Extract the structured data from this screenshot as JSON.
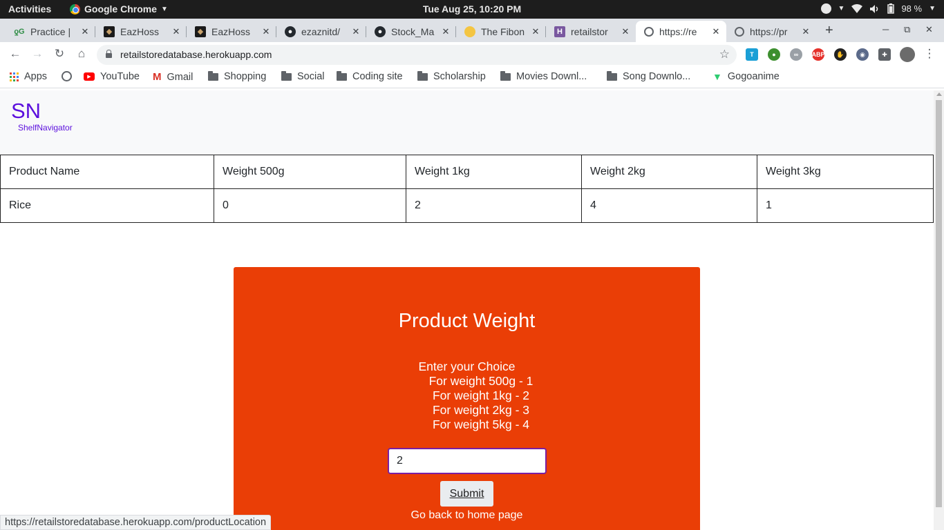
{
  "system_bar": {
    "activities": "Activities",
    "app_name": "Google Chrome",
    "clock": "Tue Aug 25, 10:20 PM",
    "battery": "98 %"
  },
  "tabs": [
    {
      "title": "Practice |",
      "favicon": "gfg-icon",
      "active": false
    },
    {
      "title": "EazHoss",
      "favicon": "page-icon",
      "active": false
    },
    {
      "title": "EazHoss",
      "favicon": "page-icon",
      "active": false
    },
    {
      "title": "ezaznitd/",
      "favicon": "github-icon",
      "active": false
    },
    {
      "title": "Stock_Ma",
      "favicon": "github-icon",
      "active": false
    },
    {
      "title": "The Fibon",
      "favicon": "person-icon",
      "active": false
    },
    {
      "title": "retailstor",
      "favicon": "heroku-icon",
      "active": false
    },
    {
      "title": "https://re",
      "favicon": "globe-icon",
      "active": true
    },
    {
      "title": "https://pr",
      "favicon": "globe-icon",
      "active": false
    }
  ],
  "toolbar": {
    "url": "retailstoredatabase.herokuapp.com"
  },
  "bookmarks": [
    {
      "label": "Apps",
      "icon": "apps-grid-icon"
    },
    {
      "label": "",
      "icon": "globe-icon"
    },
    {
      "label": "YouTube",
      "icon": "youtube-icon"
    },
    {
      "label": "Gmail",
      "icon": "gmail-icon"
    },
    {
      "label": "Shopping",
      "icon": "folder-icon"
    },
    {
      "label": "Social",
      "icon": "folder-icon"
    },
    {
      "label": "Coding site",
      "icon": "folder-icon"
    },
    {
      "label": "Scholarship",
      "icon": "folder-icon"
    },
    {
      "label": "Movies Downl...",
      "icon": "folder-icon"
    },
    {
      "label": "Song Downlo...",
      "icon": "folder-icon"
    },
    {
      "label": "Gogoanime",
      "icon": "gogoanime-icon"
    }
  ],
  "brand": {
    "short": "SN",
    "full": "ShelfNavigator",
    "color": "#5b0fdd"
  },
  "stock_table": {
    "headers": [
      "Product Name",
      "Weight 500g",
      "Weight 1kg",
      "Weight 2kg",
      "Weight 3kg"
    ],
    "rows": [
      [
        "Rice",
        "0",
        "2",
        "4",
        "1"
      ]
    ]
  },
  "form": {
    "title": "Product Weight",
    "instructions": [
      "Enter your Choice",
      "For weight 500g - 1",
      "For weight 1kg - 2",
      "For weight 2kg - 3",
      "For weight 5kg - 4"
    ],
    "input_value": "2",
    "submit_label": "Submit",
    "home_link": "Go back to home page",
    "background": "#ea3e06"
  },
  "status_url": "https://retailstoredatabase.herokuapp.com/productLocation"
}
